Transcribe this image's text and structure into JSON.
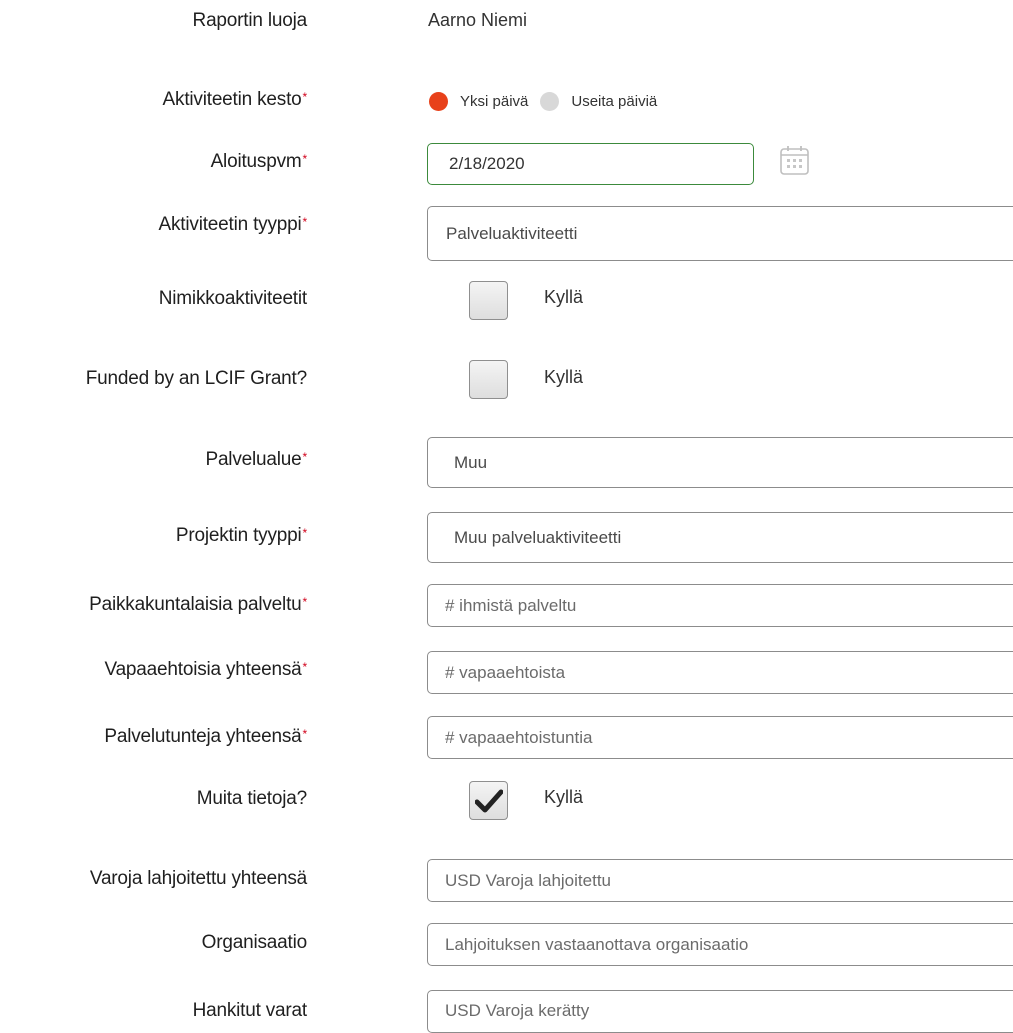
{
  "form": {
    "report_creator": {
      "label": "Raportin luoja",
      "value": "Aarno Niemi"
    },
    "activity_duration": {
      "label": "Aktiviteetin kesto",
      "required_mark": "*",
      "options": [
        {
          "label": "Yksi päivä",
          "selected": true
        },
        {
          "label": "Useita päiviä",
          "selected": false
        }
      ]
    },
    "start_date": {
      "label": "Aloituspvm",
      "required_mark": "*",
      "value": "2/18/2020"
    },
    "activity_type": {
      "label": "Aktiviteetin tyyppi",
      "required_mark": "*",
      "value": "Palveluaktiviteetti"
    },
    "signature_activities": {
      "label": "Nimikkoaktiviteetit",
      "checkbox_label": "Kyllä",
      "checked": false
    },
    "lcif_grant": {
      "label": "Funded by an LCIF Grant?",
      "checkbox_label": "Kyllä",
      "checked": false
    },
    "service_area": {
      "label": "Palvelualue",
      "required_mark": "*",
      "value": "Muu"
    },
    "project_type": {
      "label": "Projektin tyyppi",
      "required_mark": "*",
      "value": "Muu palveluaktiviteetti"
    },
    "people_served": {
      "label": "Paikkakuntalaisia palveltu",
      "required_mark": "*",
      "value": "",
      "placeholder": "# ihmistä palveltu"
    },
    "total_volunteers": {
      "label": "Vapaaehtoisia yhteensä",
      "required_mark": "*",
      "value": "",
      "placeholder": "# vapaaehtoista"
    },
    "total_service_hours": {
      "label": "Palvelutunteja yhteensä",
      "required_mark": "*",
      "value": "",
      "placeholder": "# vapaaehtoistuntia"
    },
    "more_info": {
      "label": "Muita tietoja?",
      "checkbox_label": "Kyllä",
      "checked": true
    },
    "funds_donated": {
      "label": "Varoja lahjoitettu yhteensä",
      "value": "",
      "placeholder": "USD Varoja lahjoitettu"
    },
    "organization": {
      "label": "Organisaatio",
      "value": "",
      "placeholder": "Lahjoituksen vastaanottava organisaatio"
    },
    "funds_raised": {
      "label": "Hankitut varat",
      "value": "",
      "placeholder": "USD Varoja kerätty"
    }
  },
  "colors": {
    "radio_selected": "#e8411a",
    "radio_unselected": "#d8d8d8",
    "focus_border": "#3c8a3c",
    "required_mark": "#d0021b"
  },
  "icons": {
    "date_picker": "calendar-icon",
    "checked_mark": "checkmark-icon"
  }
}
